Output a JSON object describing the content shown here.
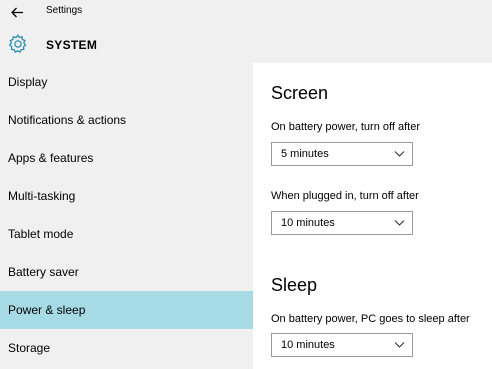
{
  "window": {
    "title": "Settings"
  },
  "header": {
    "title": "SYSTEM",
    "icon": "gear-icon",
    "accent": "#2b8fb3"
  },
  "sidebar": {
    "active_color": "#a6dbe5",
    "items": [
      {
        "label": "Display"
      },
      {
        "label": "Notifications & actions"
      },
      {
        "label": "Apps & features"
      },
      {
        "label": "Multi-tasking"
      },
      {
        "label": "Tablet mode"
      },
      {
        "label": "Battery saver"
      },
      {
        "label": "Power & sleep",
        "selected": true
      },
      {
        "label": "Storage"
      }
    ]
  },
  "main": {
    "screen": {
      "title": "Screen",
      "battery_label": "On battery power, turn off after",
      "battery_value": "5 minutes",
      "plugged_label": "When plugged in, turn off after",
      "plugged_value": "10 minutes"
    },
    "sleep": {
      "title": "Sleep",
      "battery_label": "On battery power, PC goes to sleep after",
      "battery_value": "10 minutes"
    }
  }
}
